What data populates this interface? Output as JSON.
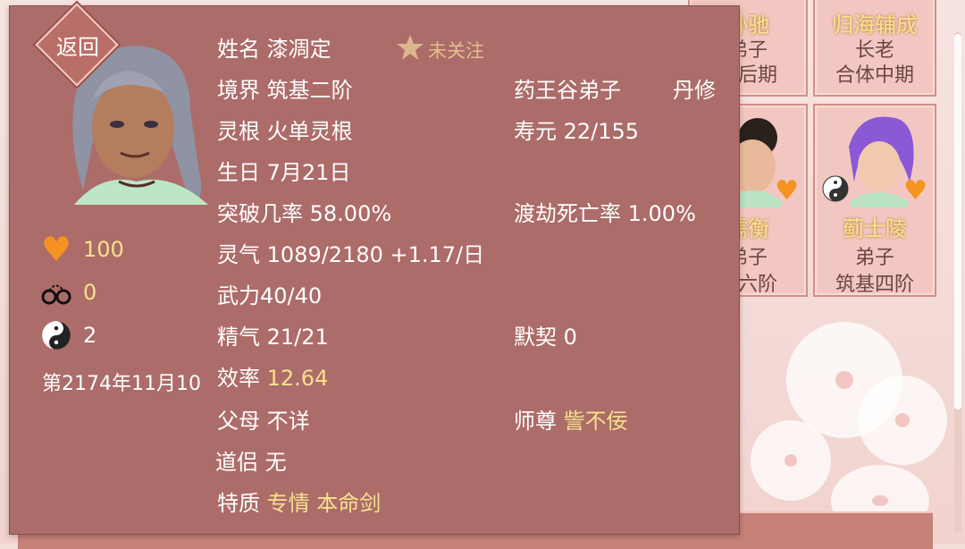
{
  "background_cards": [
    {
      "name": "孙驰",
      "role": "弟子",
      "realm": "丹后期"
    },
    {
      "name": "归海辅成",
      "role": "长老",
      "realm": "合体中期"
    },
    {
      "name": "儒衡",
      "role": "弟子",
      "realm": "基六阶"
    },
    {
      "name": "蓟士陵",
      "role": "弟子",
      "realm": "筑基四阶"
    }
  ],
  "panel": {
    "back_label": "返回",
    "follow_label": "未关注",
    "stats": {
      "heart": "100",
      "cuffs": "0",
      "yinyang": "2"
    },
    "date": "第2174年11月10",
    "name_label": "姓名",
    "name_value": "漆凋定",
    "realm_label": "境界",
    "realm_value": "筑基二阶",
    "sect": "药王谷弟子",
    "path": "丹修",
    "root_label": "灵根",
    "root_value": "火单灵根",
    "life_label": "寿元",
    "life_value": "22/155",
    "birthday_label": "生日",
    "birthday_value": "7月21日",
    "breakthrough_label": "突破几率",
    "breakthrough_value": "58.00%",
    "tribulation_label": "渡劫死亡率",
    "tribulation_value": "1.00%",
    "qi_label": "灵气",
    "qi_value": "1089/2180 +1.17/日",
    "force_text": "武力40/40",
    "essence_label": "精气",
    "essence_value": "21/21",
    "tacit_label": "默契",
    "tacit_value": "0",
    "efficiency_label": "效率",
    "efficiency_value": "12.64",
    "parents_label": "父母",
    "parents_value": "不详",
    "master_label": "师尊",
    "master_value": "訾不佞",
    "partner_label": "道侣",
    "partner_value": "无",
    "trait_label": "特质",
    "traits": [
      "专情",
      "本命剑"
    ]
  },
  "colors": {
    "panel": "#ac6c69",
    "highlight": "#f7e08e",
    "heart": "#f49320"
  }
}
